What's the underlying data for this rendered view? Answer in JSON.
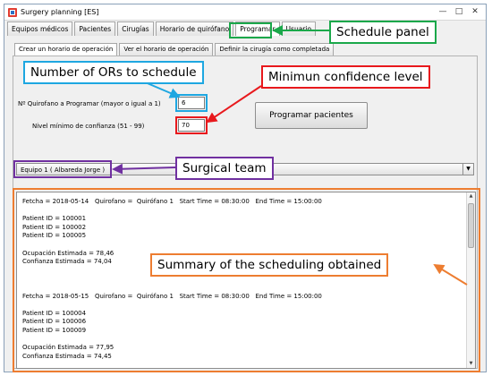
{
  "window": {
    "title": "Surgery planning [ES]",
    "controls": [
      "—",
      "□",
      "✕"
    ]
  },
  "tabs": [
    {
      "label": "Equipos médicos"
    },
    {
      "label": "Pacientes"
    },
    {
      "label": "Cirugías"
    },
    {
      "label": "Horario de quirófano"
    },
    {
      "label": "Programar"
    },
    {
      "label": "Usuario"
    }
  ],
  "subtabs": [
    {
      "label": "Crear un horario de operación"
    },
    {
      "label": "Ver el horario de operación"
    },
    {
      "label": "Definir la cirugía como completada"
    }
  ],
  "form": {
    "or_label": "Nº Quirofano a Programar (mayor o igual a 1)",
    "or_value": "6",
    "confidence_label": "Nivel mínimo de confianza (51 - 99)",
    "confidence_value": "70",
    "schedule_button": "Programar pacientes",
    "team_selected": "Equipo 1 ( Albareda Jorge )"
  },
  "summary": {
    "text": "Fetcha = 2018-05-14   Quirofano =  Quirófano 1   Start Time = 08:30:00   End Time = 15:00:00\n\nPatient ID = 100001\nPatient ID = 100002\nPatient ID = 100005\n\nOcupación Estimada = 78,46\nConfianza Estimada = 74,04\n\n\n\nFetcha = 2018-05-15   Quirofano =  Quirófano 1   Start Time = 08:30:00   End Time = 15:00:00\n\nPatient ID = 100004\nPatient ID = 100006\nPatient ID = 100009\n\nOcupación Estimada = 77,95\nConfianza Estimada = 74,45"
  },
  "annotations": {
    "schedule_panel": "Schedule panel",
    "num_ors": "Number of ORs to schedule",
    "min_confidence": "Minimun confidence level",
    "surgical_team": "Surgical team",
    "summary": "Summary of the scheduling obtained"
  },
  "colors": {
    "green": "#1aa84a",
    "blue": "#1ea7e1",
    "red": "#e8191d",
    "purple": "#7030a0",
    "orange": "#ed7d31"
  }
}
